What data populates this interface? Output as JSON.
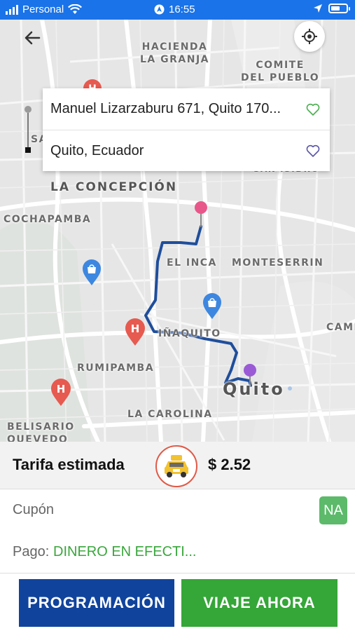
{
  "status_bar": {
    "carrier": "Personal",
    "time": "16:55"
  },
  "map": {
    "labels": {
      "hacienda": "HACIENDA\nLA GRANJA",
      "comite": "COMITE\nDEL PUEBLO",
      "concepcion": "LA CONCEPCIÓN",
      "cochapamba": "COCHAPAMBA",
      "elinca": "EL INCA",
      "monteserrin": "MONTESERRIN",
      "inaquito": "IÑAQUITO",
      "rumipamba": "RUMIPAMBA",
      "quito": "Quito",
      "lacarolina": "LA CAROLINA",
      "belisario": "BELISARIO\nQUEVEDO",
      "camp": "CAMP",
      "sanisidro": "SAN ISIDRO",
      "sa": "SA"
    },
    "hospital_letter": "H"
  },
  "route": {
    "origin": "Manuel Lizarzaburu 671, Quito 170...",
    "destination": "Quito, Ecuador"
  },
  "fare": {
    "label": "Tarifa estimada",
    "price": "$ 2.52"
  },
  "coupon": {
    "label": "Cupón",
    "badge": "NA"
  },
  "payment": {
    "label": "Pago:",
    "value": "DINERO EN EFECTI..."
  },
  "buttons": {
    "schedule": "PROGRAMACIÓN",
    "now": "VIAJE AHORA"
  },
  "colors": {
    "status_bar": "#1a73e8",
    "route_line": "#1f4e9b",
    "schedule_button": "#10439c",
    "now_button": "#35a638",
    "payment_value": "#3aa63c",
    "origin_pin": "#e8578a",
    "destination_pin": "#9a5ad6"
  }
}
